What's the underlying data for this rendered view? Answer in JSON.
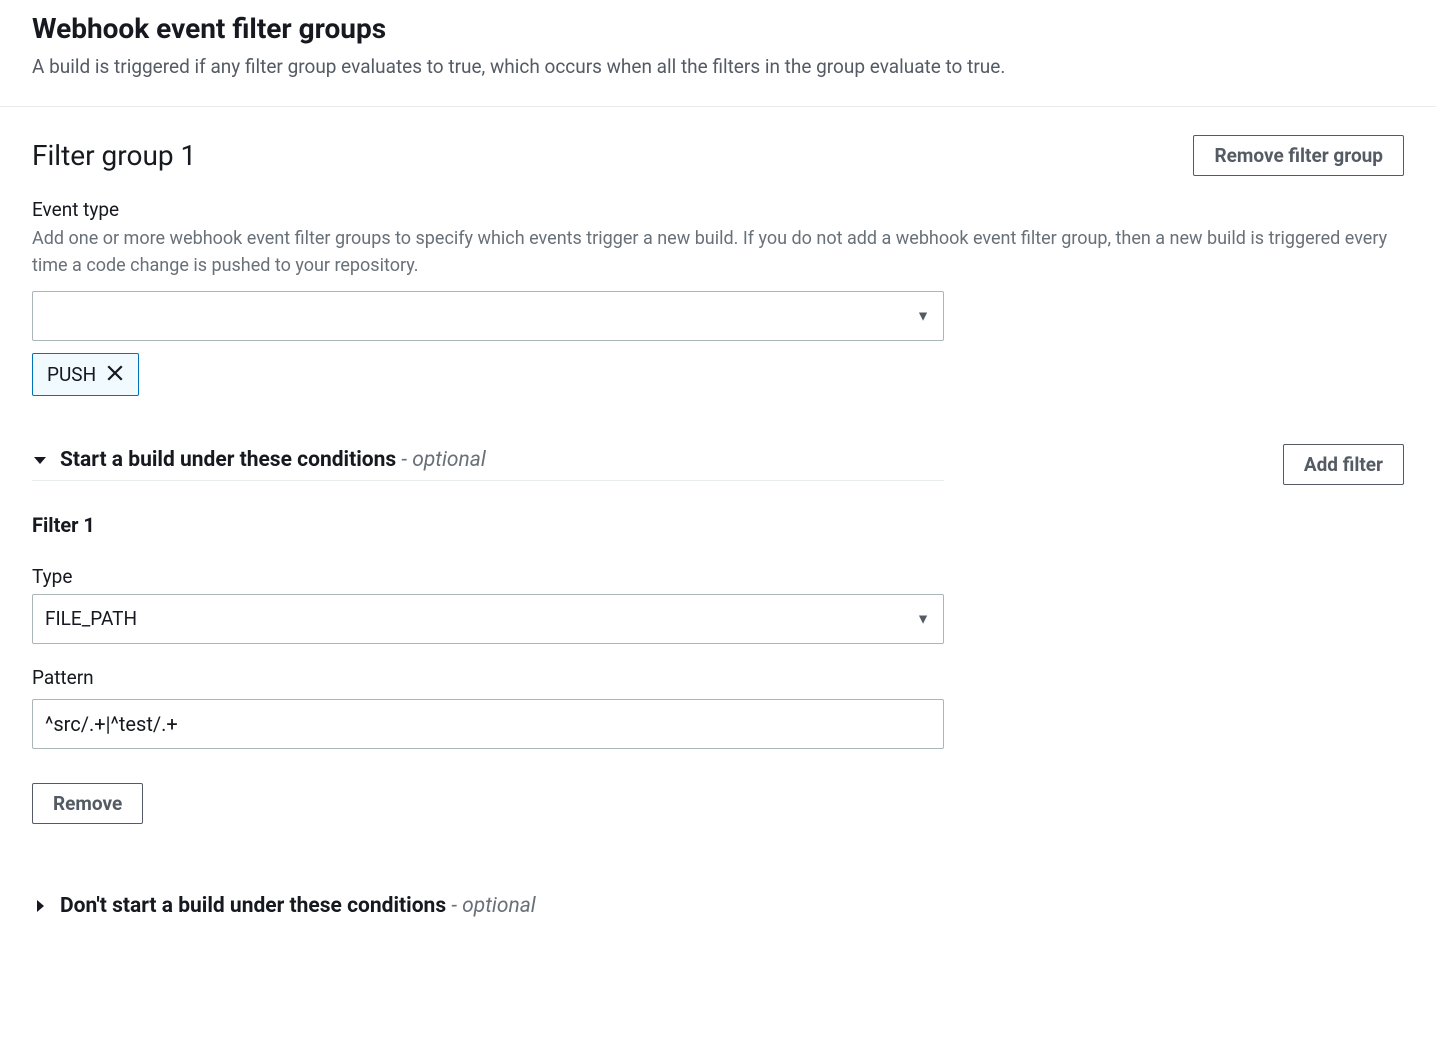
{
  "header": {
    "title": "Webhook event filter groups",
    "description": "A build is triggered if any filter group evaluates to true, which occurs when all the filters in the group evaluate to true."
  },
  "group": {
    "title": "Filter group 1",
    "removeLabel": "Remove filter group",
    "eventType": {
      "label": "Event type",
      "description": "Add one or more webhook event filter groups to specify which events trigger a new build. If you do not add a webhook event filter group, then a new build is triggered every time a code change is pushed to your repository.",
      "selectedValue": "",
      "tokens": [
        "PUSH"
      ]
    },
    "startConditions": {
      "title": "Start a build under these conditions",
      "optionalSuffix": "- ",
      "optionalLabel": "optional",
      "addFilterLabel": "Add filter",
      "filter": {
        "title": "Filter 1",
        "typeLabel": "Type",
        "typeValue": "FILE_PATH",
        "patternLabel": "Pattern",
        "patternValue": "^src/.+|^test/.+",
        "removeLabel": "Remove"
      }
    },
    "dontStartConditions": {
      "title": "Don't start a build under these conditions",
      "optionalSuffix": "- ",
      "optionalLabel": "optional"
    }
  }
}
